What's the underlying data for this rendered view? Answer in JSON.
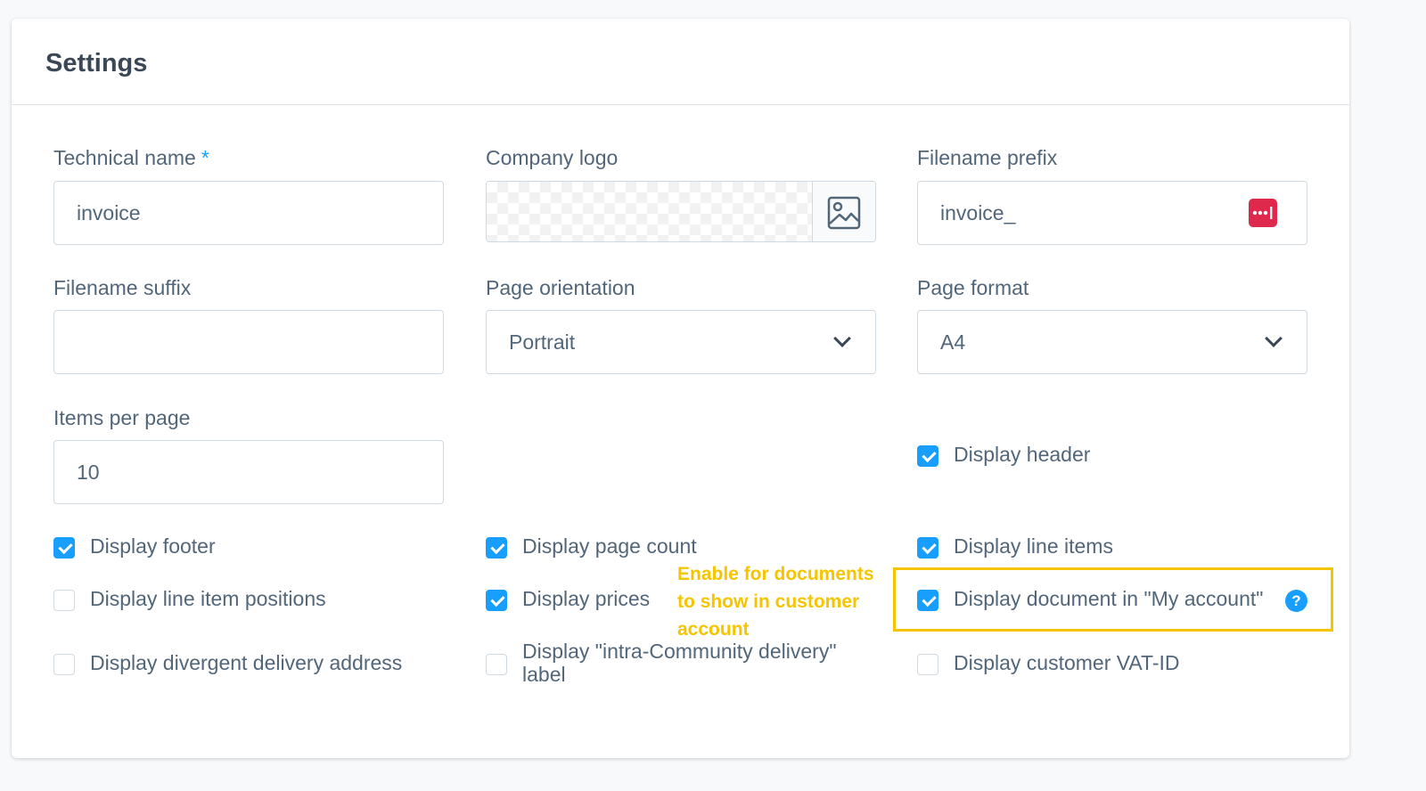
{
  "card": {
    "title": "Settings"
  },
  "fields": {
    "technical_name": {
      "label": "Technical name",
      "required_mark": "*",
      "value": "invoice"
    },
    "company_logo": {
      "label": "Company logo"
    },
    "filename_prefix": {
      "label": "Filename prefix",
      "value": "invoice_"
    },
    "filename_suffix": {
      "label": "Filename suffix",
      "value": ""
    },
    "page_orientation": {
      "label": "Page orientation",
      "value": "Portrait"
    },
    "page_format": {
      "label": "Page format",
      "value": "A4"
    },
    "items_per_page": {
      "label": "Items per page",
      "value": "10"
    }
  },
  "checkboxes": {
    "display_header": {
      "label": "Display header",
      "checked": true
    },
    "display_footer": {
      "label": "Display footer",
      "checked": true
    },
    "display_page_count": {
      "label": "Display page count",
      "checked": true
    },
    "display_line_items": {
      "label": "Display line items",
      "checked": true
    },
    "display_line_item_positions": {
      "label": "Display line item positions",
      "checked": false
    },
    "display_prices": {
      "label": "Display prices",
      "checked": true
    },
    "display_document_in_my_account": {
      "label": "Display document in \"My account\"",
      "checked": true
    },
    "display_divergent_delivery_address": {
      "label": "Display divergent delivery address",
      "checked": false
    },
    "display_intra_community_label": {
      "label": "Display \"intra-Community delivery\" label",
      "checked": false
    },
    "display_customer_vat_id": {
      "label": "Display customer VAT-ID",
      "checked": false
    }
  },
  "annotation": {
    "text": "Enable for documents to show in customer account"
  },
  "help": {
    "glyph": "?"
  },
  "colors": {
    "accent": "#189eff",
    "annotation": "#f6c400",
    "danger": "#de294c"
  },
  "icons": {
    "logo_picker": "image-icon",
    "variables": "variables-icon",
    "dropdown": "chevron-down-icon",
    "help": "help-icon"
  }
}
